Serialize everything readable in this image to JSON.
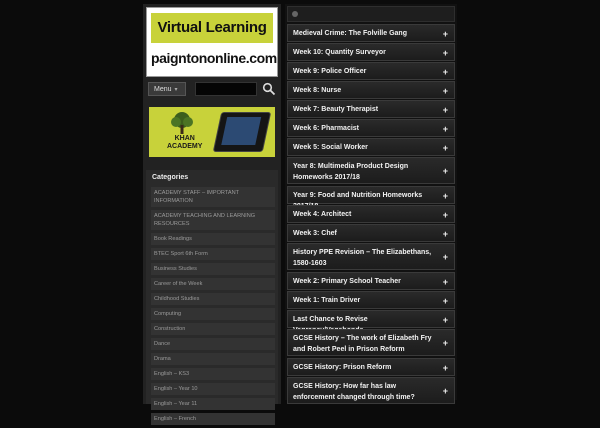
{
  "logo": {
    "line1": "Virtual Learning",
    "line2": "paigntononline.com"
  },
  "menu": {
    "label": "Menu"
  },
  "khan": {
    "line1": "KHAN",
    "line2": "ACADEMY"
  },
  "categories": {
    "title": "Categories",
    "items": [
      "ACADEMY STAFF – IMPORTANT INFORMATION",
      "ACADEMY TEACHING AND LEARNING RESOURCES",
      "Book Readings",
      "BTEC Sport 6th Form",
      "Business Studies",
      "Career of the Week",
      "Childhood Studies",
      "Computing",
      "Construction",
      "Dance",
      "Drama",
      "English – KS3",
      "English – Year 10",
      "English – Year 11",
      "English – French"
    ]
  },
  "accordion": [
    "Medieval Crime: The Folville Gang",
    "Week 10: Quantity Surveyor",
    "Week 9: Police Officer",
    "Week 8: Nurse",
    "Week 7: Beauty Therapist",
    "Week 6: Pharmacist",
    "Week 5: Social Worker",
    "Year 8: Multimedia Product Design Homeworks 2017/18",
    "Year 9: Food and Nutrition Homeworks 2017/18",
    "Week 4: Architect",
    "Week 3: Chef",
    "History PPE Revision – The Elizabethans, 1580-1603",
    "Week 2: Primary School Teacher",
    "Week 1: Train Driver",
    "Last Chance to Revise Vagrancy/Vagabonds",
    "GCSE History – The work of Elizabeth Fry and Robert Peel in Prison Reform",
    "GCSE History: Prison Reform",
    "GCSE History: How far has law enforcement changed through time?"
  ],
  "plus_symbol": "+"
}
